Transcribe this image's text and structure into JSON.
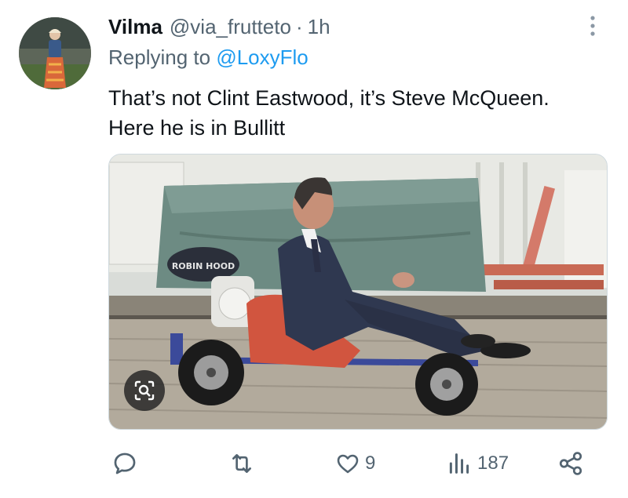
{
  "tweet": {
    "display_name": "Vilma",
    "handle": "@via_frutteto",
    "separator": "·",
    "time": "1h",
    "replying_to_prefix": "Replying to ",
    "replying_to_handle": "@LoxyFlo",
    "text_lines": [
      "That’s not Clint Eastwood, it’s Steve McQueen.",
      "Here he is in Bullitt"
    ],
    "media": {
      "sign_text": "ROBIN HOOD",
      "lens_button": "visual-search-icon"
    }
  },
  "actions": {
    "reply": {
      "icon": "reply-icon",
      "count": ""
    },
    "repost": {
      "icon": "repost-icon",
      "count": ""
    },
    "like": {
      "icon": "heart-icon",
      "count": "9"
    },
    "views": {
      "icon": "views-icon",
      "count": "187"
    },
    "share": {
      "icon": "share-icon",
      "count": ""
    }
  },
  "colors": {
    "primary_text": "#0f1419",
    "secondary_text": "#536471",
    "accent": "#1d9bf0"
  }
}
